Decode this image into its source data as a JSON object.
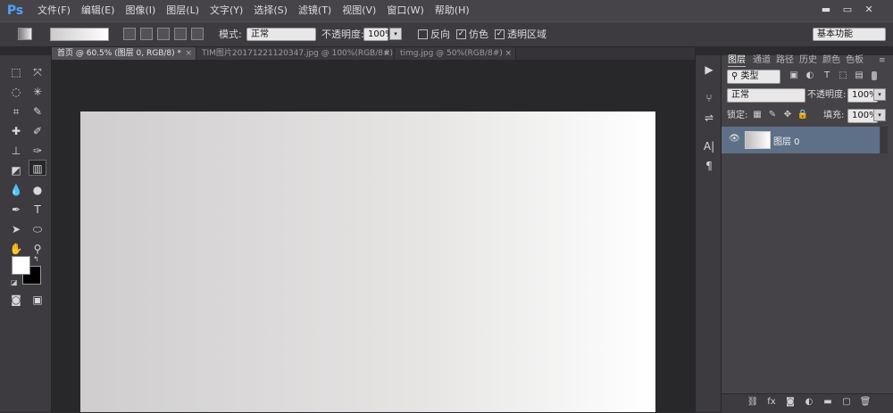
{
  "app": {
    "logo": "Ps"
  },
  "menu": [
    "文件(F)",
    "编辑(E)",
    "图像(I)",
    "图层(L)",
    "文字(Y)",
    "选择(S)",
    "滤镜(T)",
    "视图(V)",
    "窗口(W)",
    "帮助(H)"
  ],
  "window_controls": {
    "minimize": "▬",
    "restore": "▭",
    "close": "✕"
  },
  "options": {
    "mode_label": "模式:",
    "mode_value": "正常",
    "opacity_label": "不透明度:",
    "opacity_value": "100%",
    "reverse_label": "反向",
    "dither_label": "仿色",
    "transparency_label": "透明区域",
    "reverse_checked": false,
    "dither_checked": true,
    "transparency_checked": true,
    "workspace": "基本功能"
  },
  "tabs": [
    {
      "label": "首页 @ 60.5% (图层 0, RGB/8) *",
      "close": "×",
      "active": true
    },
    {
      "label": "TIM图片20171221120347.jpg @ 100%(RGB/8#)",
      "close": "×",
      "active": false
    },
    {
      "label": "timg.jpg @ 50%(RGB/8#)",
      "close": "×",
      "active": false
    }
  ],
  "layers_panel": {
    "tabs": [
      "图层",
      "通道",
      "路径",
      "历史",
      "颜色",
      "色板"
    ],
    "filter_kind": "类型",
    "blend_mode": "正常",
    "opacity_label": "不透明度:",
    "opacity_value": "100%",
    "lock_label": "锁定:",
    "fill_label": "填充:",
    "fill_value": "100%",
    "layers": [
      {
        "name": "图层 0",
        "visible": true
      }
    ]
  },
  "colors": {
    "menubar": "#464448",
    "panel": "#3d3b3f",
    "canvas_bg": "#282729",
    "selected_layer": "#5e7087",
    "accent": "#4fa3ff"
  }
}
